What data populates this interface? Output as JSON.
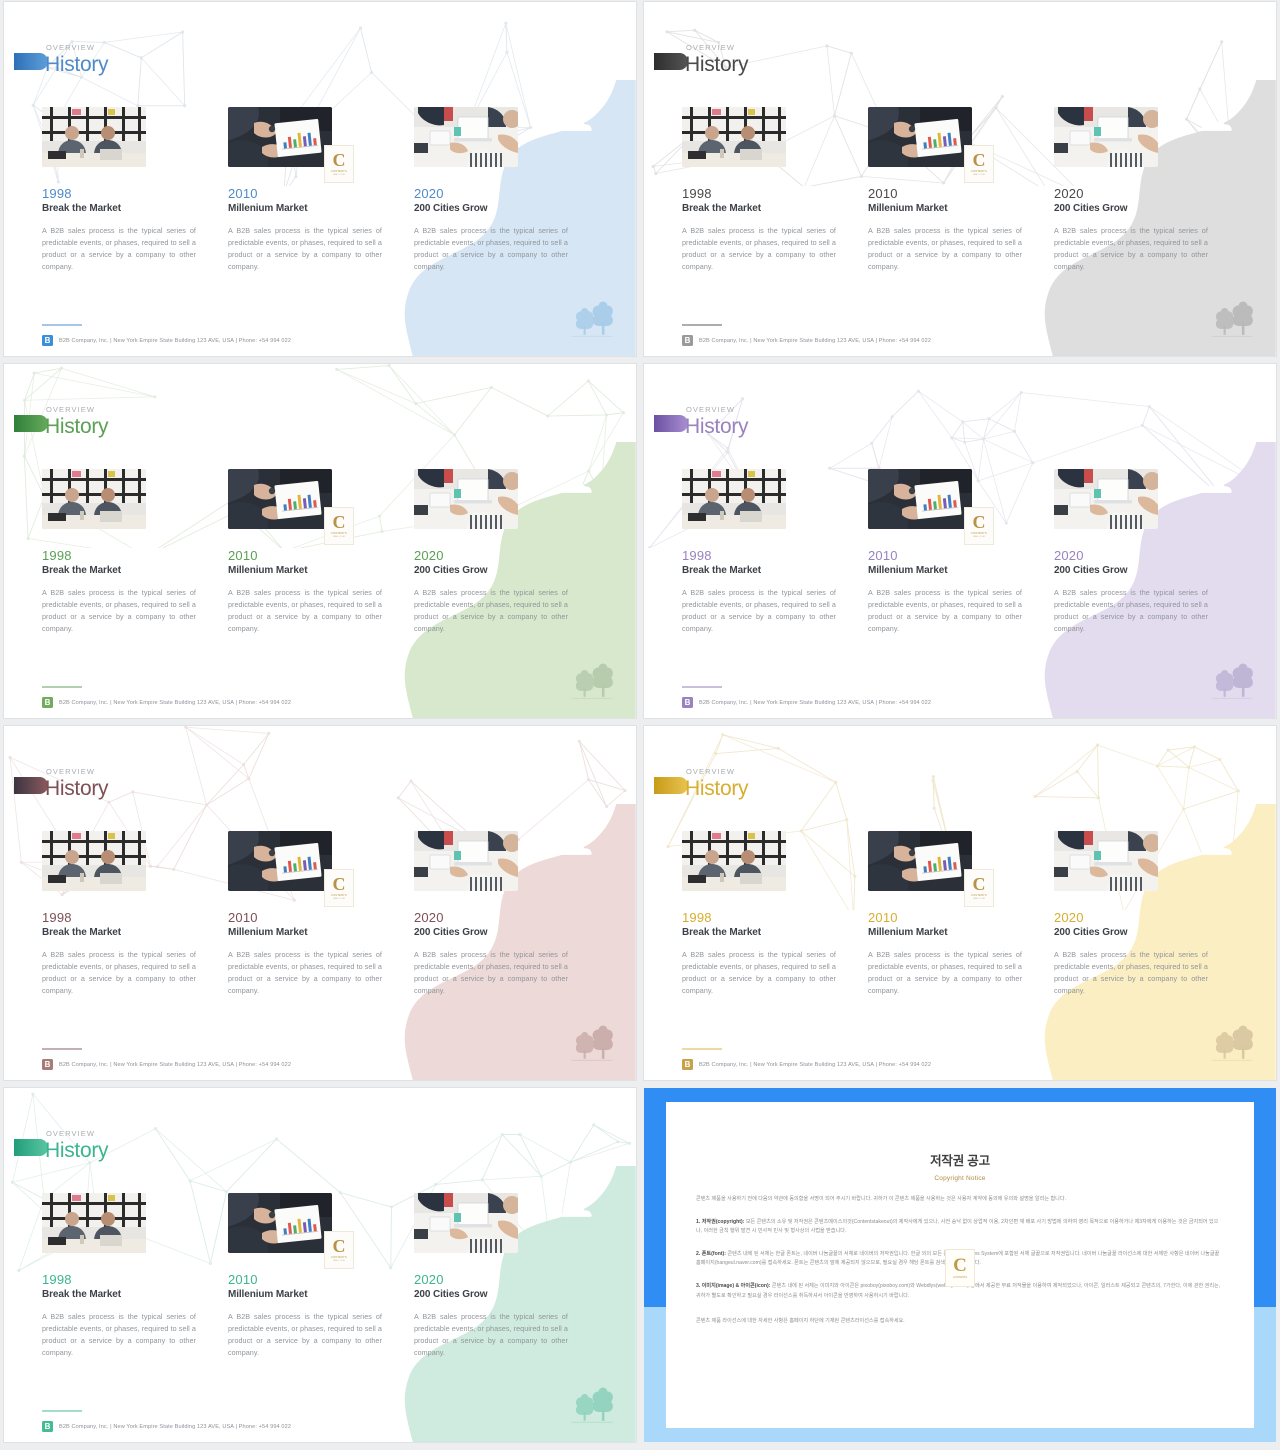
{
  "deck": {
    "slide_count": 8,
    "themes": [
      {
        "key": "blue",
        "accent": "#3b7fc4",
        "tab_from": "#2f6fb8",
        "tab_to": "#5d9fd8",
        "title": "#4f8bc9",
        "blob": "#d7e6f4",
        "trees": "#a8cbe8",
        "footer_logo": "#3b8fd8",
        "mesh": "#dfe6ec",
        "bg_tint": "#f4f8fc"
      },
      {
        "key": "gray",
        "accent": "#4a4a4a",
        "tab_from": "#2d2d2d",
        "tab_to": "#555555",
        "title": "#4a4a4a",
        "blob": "#dedede",
        "trees": "#b8b8b8",
        "footer_logo": "#9a9a9a",
        "mesh": "#e2e2e2",
        "bg_tint": "#f2f2f2"
      },
      {
        "key": "green",
        "accent": "#4f9a4f",
        "tab_from": "#2f7f3a",
        "tab_to": "#67ab5c",
        "title": "#5ba055",
        "blob": "#d7e8cd",
        "trees": "#b5c9ab",
        "footer_logo": "#72ab5e",
        "mesh": "#e2ecdd",
        "bg_tint": "#f4f8f1"
      },
      {
        "key": "purple",
        "accent": "#8a6fb5",
        "tab_from": "#6b4fa3",
        "tab_to": "#a98fd0",
        "title": "#9a82c0",
        "blob": "#e3dcee",
        "trees": "#bdb3d3",
        "footer_logo": "#9a82c0",
        "mesh": "#e6e3ec",
        "bg_tint": "#f7f5fa"
      },
      {
        "key": "rose",
        "accent": "#7d5056",
        "tab_from": "#3c3440",
        "tab_to": "#8a5a5f",
        "title": "#7d5056",
        "blob": "#edd9d7",
        "trees": "#c9adaa",
        "footer_logo": "#a87b78",
        "mesh": "#ece0de",
        "bg_tint": "#faf3f2"
      },
      {
        "key": "yellow",
        "accent": "#d6ab2e",
        "tab_from": "#c89b18",
        "tab_to": "#e8c451",
        "title": "#d8ad30",
        "blob": "#fbeec2",
        "trees": "#d8c6a0",
        "footer_logo": "#c8a24a",
        "mesh": "#f1e7cd",
        "bg_tint": "#fdfaf0"
      },
      {
        "key": "teal",
        "accent": "#36b08a",
        "tab_from": "#1f9e78",
        "tab_to": "#5cc5a3",
        "title": "#3bb590",
        "blob": "#cfeade",
        "trees": "#8fd2bd",
        "footer_logo": "#44bb96",
        "mesh": "#dcece7",
        "bg_tint": "#f1faf6"
      }
    ]
  },
  "slide": {
    "overview_label": "OVERVIEW",
    "title": "History",
    "footer": {
      "logo_glyph": "B",
      "text": "B2B Company, Inc.  |  New York Empire State Building 123 AVE, USA  |  Phone: +54 994 022"
    },
    "watermark": {
      "glyph": "C",
      "sub": "CONTENTS",
      "sub2": "MALL.COM"
    },
    "columns": [
      {
        "year": "1998",
        "heading": "Break the Market",
        "body": "A B2B sales process is the typical series of predictable events, or phases, required to sell a product or a service by a company to other company.",
        "photo": "photo-meeting-two-men"
      },
      {
        "year": "2010",
        "heading": "Millenium Market",
        "body": "A B2B sales process is the typical series of predictable events, or phases, required to sell a product or a service by a company to other company.",
        "photo": "photo-hands-tablet-chart"
      },
      {
        "year": "2020",
        "heading": "200 Cities Grow",
        "body": "A B2B sales process is the typical series of predictable events, or phases, required to sell a product or a service by a company to other company.",
        "photo": "photo-desk-laptop-team"
      }
    ]
  },
  "copyright_slide": {
    "title_ko": "저작권 공고",
    "title_en": "Copyright Notice",
    "intro": "콘텐츠 제품을 사용하기 전에 다음의 약관에 동의함을 서명이 되어 주시기 바랍니다. 귀하가 이 콘텐츠 제품을 사용하는 것은 사용자 계약에 동의에 유의와 설명을 알리는 합니다.",
    "items": [
      {
        "label": "1. 저작권(copyright):",
        "text": "모든 콘텐츠의 소유 및 저작권은 콘텐츠메이스의것(Contentstakeout)의 제작사에게 있으나, 사전 승낙 없이 상업적 이용, 2차인편 재 배포 사기 방법에 의하여 영리 목적으로 이용하거나 제3자에게 이용하는 것은 금지되어 있으나, 이러한 금칙 행위 발견 시 민사적 민사 및 형사상의 사법을 받습니다."
      },
      {
        "label": "2. 폰트(font):",
        "text": "콘텐츠 내에 된 서체는 한글 폰트는, 네이버 나눔글꼴의 서체로 네이버의 저작권입니다. 한글 외의 모든 폰트는 Windows System에 포함된 서체 글꼴으로 저작권입니다. 네이버 나눔글꼴 라이선스에 대한 서체만 사항은 네이버 나눔글꼴 홈페이지(hangeul.naver.com)를 접속하세요. 폰트는 콘텐츠의 말에 제공되지 않으므로, 필요실 경우 해당 폰트를 검색하시기 바랍니다."
      },
      {
        "label": "3. 이미지(image) & 아이콘(icon):",
        "text": "콘텐츠 내에 된 서체는 이미지와 아이콘은 pixoboy(pixoboy.com)와 Webdlys(webolys.com) 등에서 제공한 무료 저작물을 이용하여 제작되었으나, 아이콘, 일러스트 제공되고 콘텐츠의, 7가한다, 이에 관한 권리는, 귀하가 별도로 확인하고 필요실 경우 라이선스를 취득하셔서 아이콘을 반영하여 사용하시기 바랍니다."
      }
    ],
    "outro": "콘텐츠 제품 라이선스에 대한 자세한 사항은 홈페이지 하단에 기재된 콘텐츠라이선스를 접속하세요.",
    "watermark": {
      "glyph": "C",
      "sub": "CONTENTS"
    }
  }
}
